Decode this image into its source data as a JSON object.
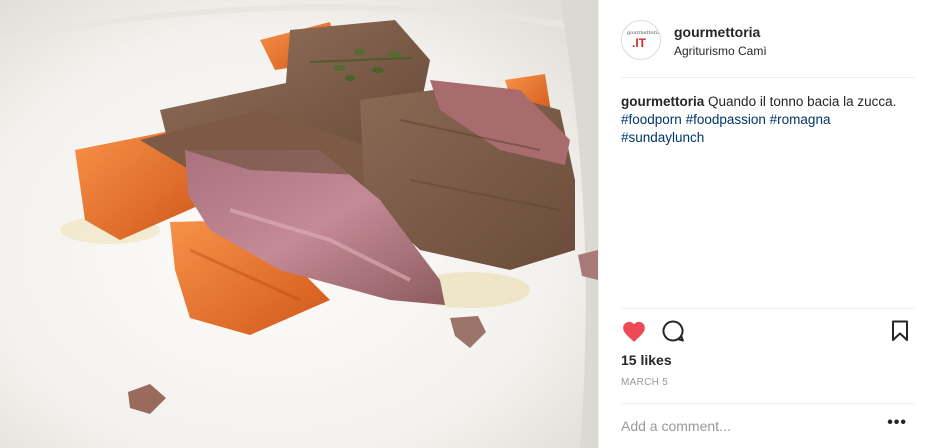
{
  "post": {
    "username": "gourmettoria",
    "location": "Agriturismo Camì",
    "avatar": {
      "top_text": "gourmettoria",
      "brand_text": ".IT",
      "brand_color": "#d7262e"
    },
    "caption": {
      "username": "gourmettoria",
      "text": "Quando il tonno bacia la zucca.",
      "hashtags": [
        "#foodporn",
        "#foodpassion",
        "#romagna",
        "#sundaylunch"
      ]
    },
    "likes": "15 likes",
    "date": "MARCH 5",
    "liked": true,
    "like_color": "#ed4956",
    "comment_placeholder": "Add a comment...",
    "more_label": "•••"
  },
  "photo": {
    "subject": "seared tuna slices with roasted pumpkin on a white plate",
    "icons": [
      "heart-icon",
      "comment-icon",
      "bookmark-icon",
      "more-icon"
    ]
  }
}
